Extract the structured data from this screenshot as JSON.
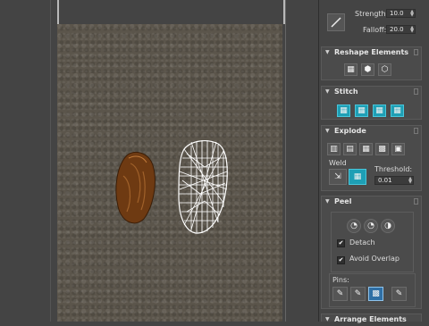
{
  "soft_selection": {
    "strength_label": "Strength:",
    "strength_value": "10.0",
    "falloff_label": "Falloff:",
    "falloff_value": "20.0"
  },
  "reshape": {
    "title": "Reshape Elements"
  },
  "stitch": {
    "title": "Stitch"
  },
  "explode": {
    "title": "Explode",
    "weld_label": "Weld",
    "threshold_label": "Threshold:",
    "threshold_value": "0.01"
  },
  "peel": {
    "title": "Peel",
    "detach_label": "Detach",
    "detach_checked": true,
    "avoid_overlap_label": "Avoid Overlap",
    "avoid_overlap_checked": true,
    "pins_label": "Pins:"
  },
  "arrange": {
    "title": "Arrange Elements"
  },
  "colors": {
    "panel_bg": "#444444",
    "rollout_bg": "#4b4b4b",
    "active_button": "#1e9fb5",
    "texture": "#5b554b",
    "uv_cluster": "#7a3e10"
  }
}
